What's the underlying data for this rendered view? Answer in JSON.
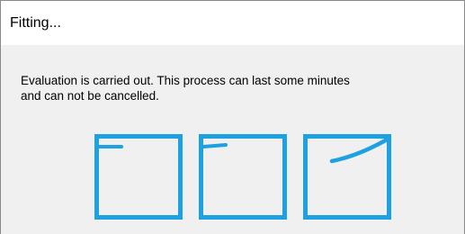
{
  "window": {
    "title": "Fitting..."
  },
  "message": {
    "line1": "Evaluation is carried out. This process can last some minutes",
    "line2": "and can not be cancelled."
  },
  "progress_icons": [
    {
      "name": "fit-graph-icon-1",
      "color": "#1ea1e0",
      "stroke": "flat-short"
    },
    {
      "name": "fit-graph-icon-2",
      "color": "#1ea1e0",
      "stroke": "flat-short"
    },
    {
      "name": "fit-graph-icon-3",
      "color": "#1ea1e0",
      "stroke": "rising-curve"
    }
  ]
}
